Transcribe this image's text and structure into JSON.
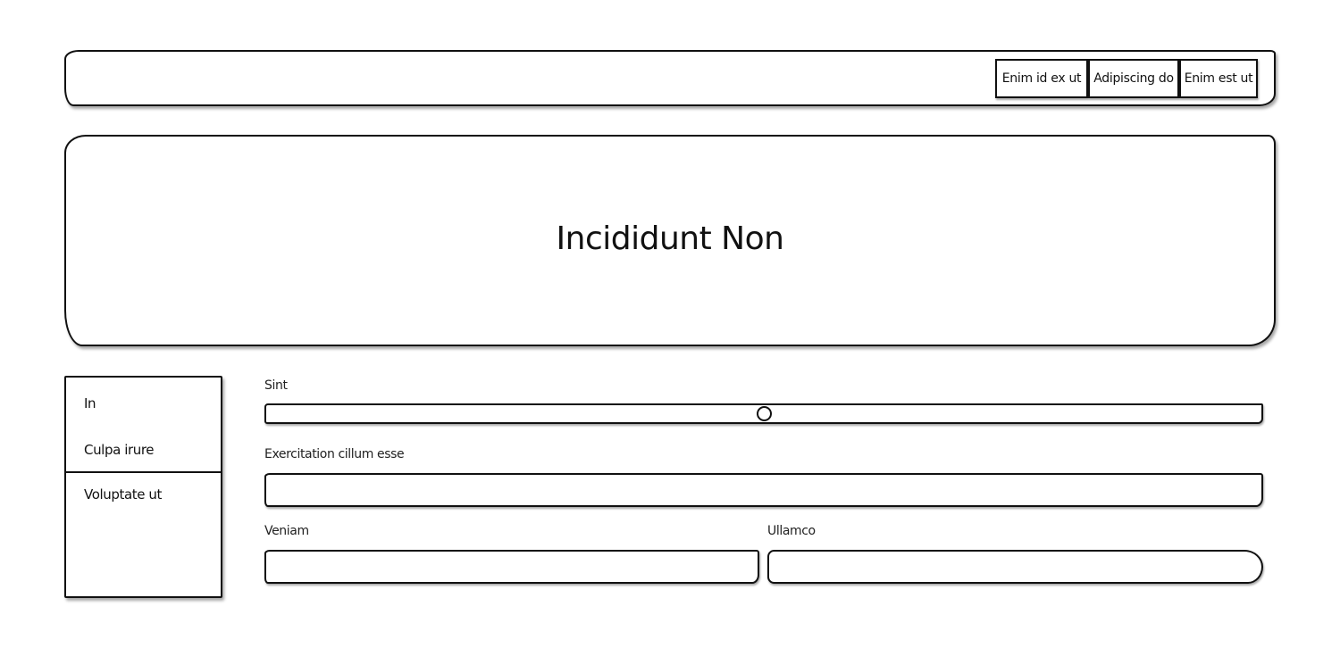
{
  "navbar": {
    "buttons": [
      "Enim id ex ut",
      "Adipiscing do",
      "Enim est ut"
    ]
  },
  "hero": {
    "title": "Incididunt Non"
  },
  "sidebar": {
    "items": [
      {
        "label": "In"
      },
      {
        "label": "Culpa irure"
      },
      {
        "label": "Voluptate ut"
      }
    ]
  },
  "form": {
    "slider": {
      "label": "Sint",
      "value": 0.5
    },
    "exercitation": {
      "label": "Exercitation cillum esse",
      "value": ""
    },
    "veniam": {
      "label": "Veniam",
      "value": ""
    },
    "ullamco": {
      "label": "Ullamco",
      "value": ""
    }
  },
  "colors": {
    "stroke": "#111111",
    "background": "#ffffff"
  }
}
